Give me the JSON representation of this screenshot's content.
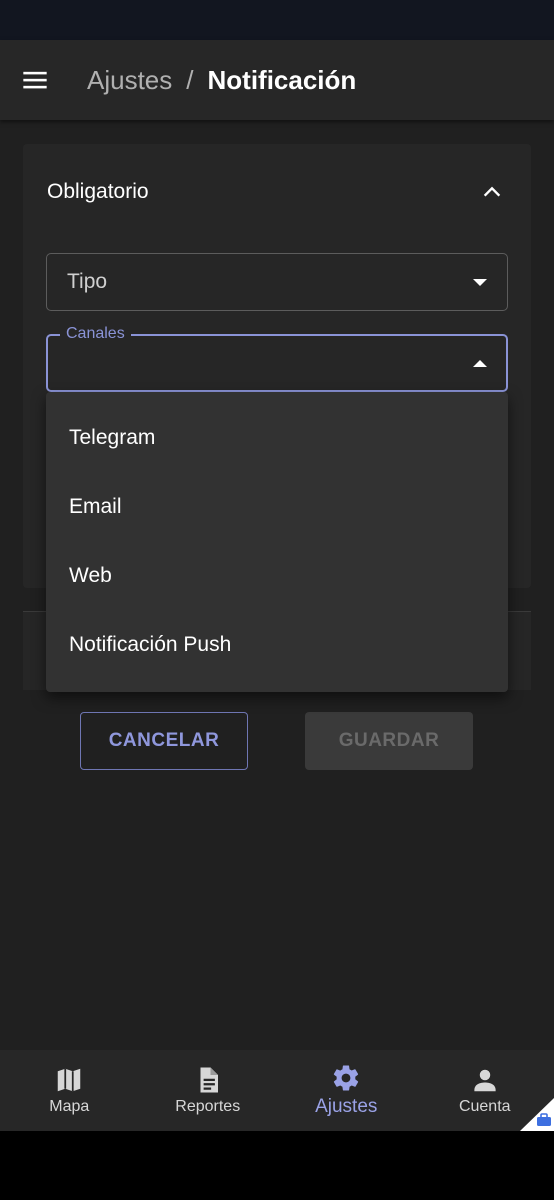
{
  "header": {
    "breadcrumb_parent": "Ajustes",
    "breadcrumb_separator": "/",
    "breadcrumb_current": "Notificación"
  },
  "panel": {
    "title": "Obligatorio",
    "expanded": true
  },
  "fields": {
    "tipo_placeholder": "Tipo",
    "canales_label": "Canales",
    "canales_value": ""
  },
  "dropdown": {
    "options": [
      "Telegram",
      "Email",
      "Web",
      "Notificación Push"
    ]
  },
  "actions": {
    "cancel_label": "CANCELAR",
    "save_label": "GUARDAR"
  },
  "nav": {
    "items": [
      {
        "label": "Mapa",
        "icon": "map-icon"
      },
      {
        "label": "Reportes",
        "icon": "document-icon"
      },
      {
        "label": "Ajustes",
        "icon": "gear-icon",
        "active": true
      },
      {
        "label": "Cuenta",
        "icon": "person-icon"
      }
    ]
  },
  "colors": {
    "accent": "#8a93d6",
    "surface": "#262626",
    "background": "#202020"
  }
}
